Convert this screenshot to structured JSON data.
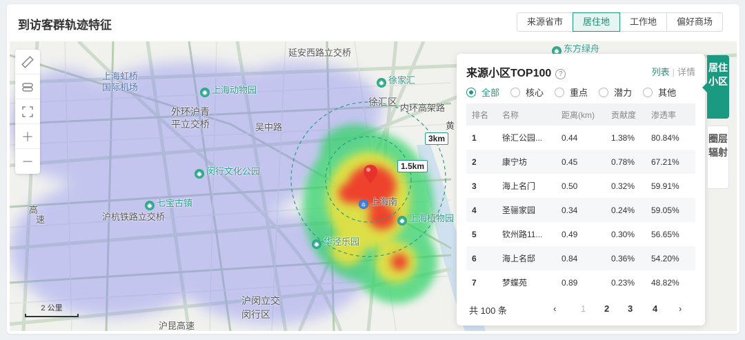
{
  "header": {
    "title": "到访客群轨迹特征"
  },
  "segments": [
    {
      "label": "来源省市",
      "active": false
    },
    {
      "label": "居住地",
      "active": true
    },
    {
      "label": "工作地",
      "active": false
    },
    {
      "label": "偏好商场",
      "active": false
    }
  ],
  "map": {
    "labels": {
      "yanan": "延安西路立交桥",
      "hongqiao1": "上海虹桥",
      "hongqiao2": "国际机场",
      "zoo": "上海动物园",
      "xujiahui": "徐家汇",
      "xuhui": "徐汇区",
      "waihuan1": "外环沪青",
      "waihuan2": "平立交桥",
      "wuzhong": "吴中路",
      "neihuan": "内环高架路",
      "minhang_culture": "闵行文化公园",
      "qibao": "七宝古镇",
      "huhang": "沪杭铁路立交桥",
      "shanghainan": "上海南",
      "botanical": "上海植物园",
      "huamin": "华泾乐园",
      "humin": "沪闵立交",
      "minhang": "闵行区",
      "hujin": "沪昆高速",
      "gaosu1": "高",
      "gaosu2": "速",
      "dongfang": "东方绿舟",
      "huangpu": "黄"
    },
    "scale_label": "2 公里",
    "ring_labels": {
      "outer": "3km",
      "inner": "1.5km"
    },
    "tools": [
      "ruler-icon",
      "layers-icon",
      "fullscreen-icon",
      "zoom-in-icon",
      "zoom-out-icon"
    ]
  },
  "panel": {
    "title": "来源小区TOP100",
    "help": "?",
    "view_list": "列表",
    "view_sep": "|",
    "view_detail": "详情",
    "filters": [
      {
        "label": "全部",
        "selected": true
      },
      {
        "label": "核心",
        "selected": false
      },
      {
        "label": "重点",
        "selected": false
      },
      {
        "label": "潜力",
        "selected": false
      },
      {
        "label": "其他",
        "selected": false
      }
    ],
    "columns": [
      "排名",
      "名称",
      "距离(km)",
      "贡献度",
      "渗透率"
    ],
    "rows": [
      [
        "1",
        "徐汇公园...",
        "0.44",
        "1.38%",
        "80.84%"
      ],
      [
        "2",
        "康宁坊",
        "0.45",
        "0.78%",
        "67.21%"
      ],
      [
        "3",
        "海上名门",
        "0.50",
        "0.32%",
        "59.91%"
      ],
      [
        "4",
        "圣骊家园",
        "0.34",
        "0.24%",
        "59.05%"
      ],
      [
        "5",
        "钦州路11...",
        "0.49",
        "0.30%",
        "56.65%"
      ],
      [
        "6",
        "海上名邸",
        "0.84",
        "0.36%",
        "54.20%"
      ],
      [
        "7",
        "梦蝶苑",
        "0.89",
        "0.23%",
        "48.82%"
      ]
    ],
    "pager": {
      "total": "共 100 条",
      "prev": "‹",
      "pages": [
        "1",
        "2",
        "3",
        "4"
      ],
      "next": "›"
    }
  },
  "side_tabs": [
    {
      "label": "居住小区",
      "active": true
    },
    {
      "label": "圈层辐射",
      "active": false
    }
  ]
}
